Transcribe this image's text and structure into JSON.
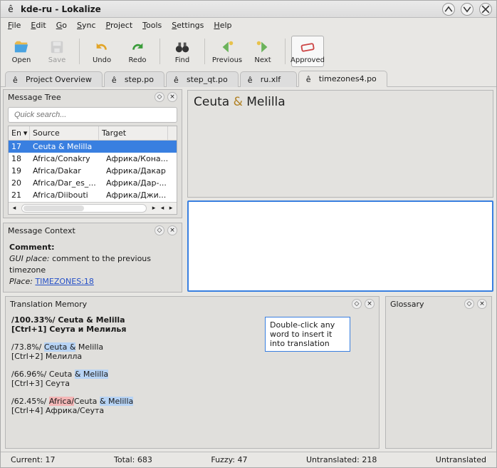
{
  "window": {
    "title": "kde-ru - Lokalize"
  },
  "menu": [
    "File",
    "Edit",
    "Go",
    "Sync",
    "Project",
    "Tools",
    "Settings",
    "Help"
  ],
  "toolbar": {
    "open": "Open",
    "save": "Save",
    "undo": "Undo",
    "redo": "Redo",
    "find": "Find",
    "previous": "Previous",
    "next": "Next",
    "approved": "Approved"
  },
  "tabs": [
    {
      "label": "Project Overview",
      "active": false
    },
    {
      "label": "step.po",
      "active": false
    },
    {
      "label": "step_qt.po",
      "active": false
    },
    {
      "label": "ru.xlf",
      "active": false
    },
    {
      "label": "timezones4.po",
      "active": true
    }
  ],
  "message_tree": {
    "title": "Message Tree",
    "quick_placeholder": "Quick search...",
    "headers": {
      "en": "En",
      "source": "Source",
      "target": "Target"
    },
    "rows": [
      {
        "en": "17",
        "source": "Ceuta & Melilla",
        "target": ""
      },
      {
        "en": "18",
        "source": "Africa/Conakry",
        "target": "Африка/Кона..."
      },
      {
        "en": "19",
        "source": "Africa/Dakar",
        "target": "Африка/Дакар"
      },
      {
        "en": "20",
        "source": "Africa/Dar_es_...",
        "target": "Африка/Дар-..."
      },
      {
        "en": "21",
        "source": "Africa/Diibouti",
        "target": "Африка/Джи..."
      }
    ],
    "selected_index": 0
  },
  "context": {
    "title": "Message Context",
    "comment_label": "Comment:",
    "gui_label": "GUI place:",
    "gui_text": "comment to the previous timezone",
    "place_label": "Place:",
    "place_link": "TIMEZONES:18"
  },
  "editor": {
    "source_pre": "Ceuta ",
    "source_amp": "&",
    "source_post": " Melilla",
    "target": ""
  },
  "tm": {
    "title": "Translation Memory",
    "tooltip": "Double-click any word to insert it into translation",
    "entries": [
      {
        "score": "/100.33%/",
        "src_pre": "",
        "src_hl": "",
        "src_post": " Ceuta & Melilla",
        "shortcut": "[Ctrl+1] ",
        "trg": "Сеута и Мелилья",
        "bold": true
      },
      {
        "score": "/73.8%/ ",
        "src_pre": "",
        "src_hl_blue": "Ceuta &",
        "src_post": " Melilla",
        "shortcut": "[Ctrl+2] ",
        "trg": "Мелилла",
        "bold": false
      },
      {
        "score": "/66.96%/ ",
        "src_pre": "Ceuta ",
        "src_hl_blue": "& Melilla",
        "src_post": "",
        "shortcut": "[Ctrl+3] ",
        "trg": "Сеута",
        "bold": false
      },
      {
        "score": "/62.45%/ ",
        "src_hl_red": "Africa/",
        "src_mid": "Ceuta ",
        "src_hl_blue": "& Melilla",
        "src_post": "",
        "shortcut": "[Ctrl+4] ",
        "trg": "Африка/Сеута",
        "bold": false
      }
    ]
  },
  "glossary": {
    "title": "Glossary"
  },
  "status": {
    "current_lbl": "Current: ",
    "current": "17",
    "total_lbl": "Total: ",
    "total": "683",
    "fuzzy_lbl": "Fuzzy: ",
    "fuzzy": "47",
    "untranslated_lbl": "Untranslated: ",
    "untranslated": "218",
    "state": "Untranslated"
  }
}
